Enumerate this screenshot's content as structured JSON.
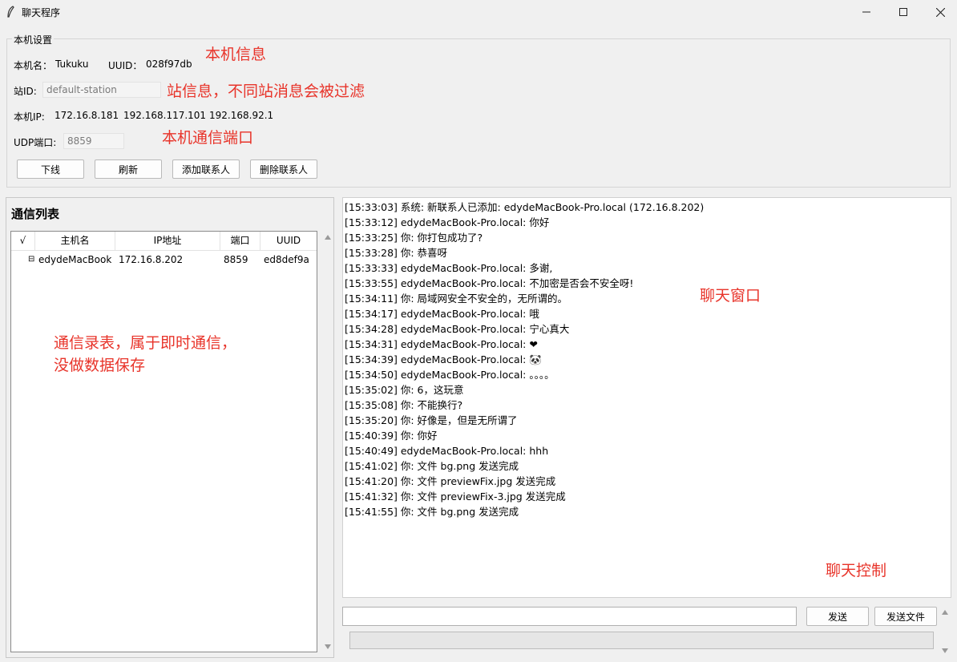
{
  "window": {
    "title": "聊天程序"
  },
  "settings": {
    "legend": "本机设置",
    "hostname_label": "本机名：",
    "hostname": "Tukuku",
    "uuid_label": "UUID：",
    "uuid": "028f97db",
    "station_label": "站ID:",
    "station_value": "default-station",
    "ip_label": "本机IP:",
    "ips": [
      "172.16.8.181",
      "192.168.117.101",
      "192.168.92.1"
    ],
    "udp_label": "UDP端口:",
    "udp_value": "8859",
    "buttons": {
      "offline": "下线",
      "refresh": "刷新",
      "add_contact": "添加联系人",
      "delete_contact": "删除联系人"
    }
  },
  "annotations": {
    "local_info": "本机信息",
    "station_info": "站信息，不同站消息会被过滤",
    "port_info": "本机通信端口",
    "list_note_1": "通信录表，属于即时通信，",
    "list_note_2": "没做数据保存",
    "chat_window": "聊天窗口",
    "chat_control": "聊天控制"
  },
  "contacts": {
    "title": "通信列表",
    "columns": [
      "√",
      "主机名",
      "IP地址",
      "端口",
      "UUID"
    ],
    "rows": [
      {
        "check": "⊟",
        "hostname": "edydeMacBook",
        "ip": "172.16.8.202",
        "port": "8859",
        "uuid": "ed8def9a"
      }
    ]
  },
  "messages": [
    "[15:33:03] 系统: 新联系人已添加: edydeMacBook-Pro.local (172.16.8.202)",
    "[15:33:12] edydeMacBook-Pro.local: 你好",
    "[15:33:25] 你: 你打包成功了?",
    "[15:33:28] 你: 恭喜呀",
    "[15:33:33] edydeMacBook-Pro.local: 多谢,",
    "[15:33:55] edydeMacBook-Pro.local: 不加密是否会不安全呀!",
    "[15:34:11] 你: 局域网安全不安全的，无所谓的。",
    "[15:34:17] edydeMacBook-Pro.local: 哦",
    "[15:34:28] edydeMacBook-Pro.local: 宁心真大",
    "[15:34:31] edydeMacBook-Pro.local: ❤",
    "[15:34:39] edydeMacBook-Pro.local: 🐼",
    "[15:34:50] edydeMacBook-Pro.local: 。。。。",
    "[15:35:02] 你: 6，这玩意",
    "[15:35:08] 你: 不能换行?",
    "[15:35:20] 你: 好像是，但是无所谓了",
    "[15:40:39] 你: 你好",
    "[15:40:49] edydeMacBook-Pro.local: hhh",
    "[15:41:02] 你: 文件 bg.png 发送完成",
    "[15:41:20] 你: 文件 previewFix.jpg 发送完成",
    "[15:41:32] 你: 文件 previewFix-3.jpg 发送完成",
    "[15:41:55] 你: 文件 bg.png 发送完成"
  ],
  "controls": {
    "send": "发送",
    "send_file": "发送文件",
    "input_value": ""
  }
}
